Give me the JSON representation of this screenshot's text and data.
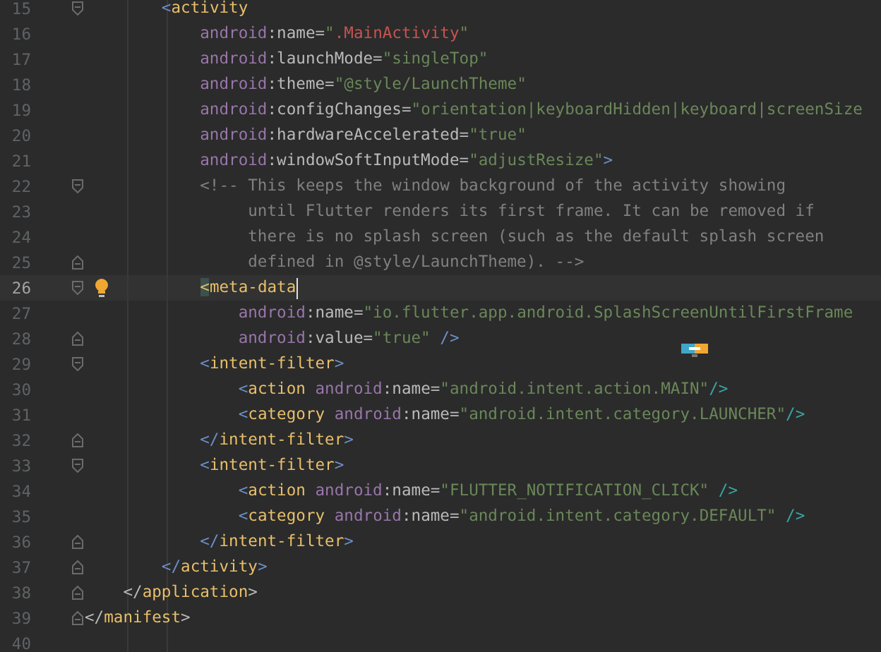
{
  "editor": {
    "lines": [
      {
        "number": "15",
        "fold": {
          "kind": "start"
        },
        "current": false,
        "bulb": false,
        "cursor": false,
        "tokens": [
          {
            "kind": "punct",
            "text": "        <"
          },
          {
            "kind": "tag",
            "text": "activity"
          }
        ]
      },
      {
        "number": "16",
        "current": false,
        "bulb": false,
        "cursor": false,
        "tokens": [
          {
            "kind": "ns",
            "text": "            android"
          },
          {
            "kind": "attr",
            "text": ":name="
          },
          {
            "kind": "str",
            "text": "\""
          },
          {
            "kind": "err",
            "text": ".MainActivity"
          },
          {
            "kind": "str",
            "text": "\""
          }
        ]
      },
      {
        "number": "17",
        "current": false,
        "bulb": false,
        "cursor": false,
        "tokens": [
          {
            "kind": "ns",
            "text": "            android"
          },
          {
            "kind": "attr",
            "text": ":launchMode="
          },
          {
            "kind": "str",
            "text": "\"singleTop\""
          }
        ]
      },
      {
        "number": "18",
        "current": false,
        "bulb": false,
        "cursor": false,
        "tokens": [
          {
            "kind": "ns",
            "text": "            android"
          },
          {
            "kind": "attr",
            "text": ":theme="
          },
          {
            "kind": "str",
            "text": "\"@style/LaunchTheme\""
          }
        ]
      },
      {
        "number": "19",
        "current": false,
        "bulb": false,
        "cursor": false,
        "tokens": [
          {
            "kind": "ns",
            "text": "            android"
          },
          {
            "kind": "attr",
            "text": ":configChanges="
          },
          {
            "kind": "str",
            "text": "\"orientation|keyboardHidden|keyboard|screenSize"
          }
        ]
      },
      {
        "number": "20",
        "current": false,
        "bulb": false,
        "cursor": false,
        "tokens": [
          {
            "kind": "ns",
            "text": "            android"
          },
          {
            "kind": "attr",
            "text": ":hardwareAccelerated="
          },
          {
            "kind": "str",
            "text": "\"true\""
          }
        ]
      },
      {
        "number": "21",
        "current": false,
        "bulb": false,
        "cursor": false,
        "tokens": [
          {
            "kind": "ns",
            "text": "            android"
          },
          {
            "kind": "attr",
            "text": ":windowSoftInputMode="
          },
          {
            "kind": "str",
            "text": "\"adjustResize\""
          },
          {
            "kind": "punct",
            "text": ">"
          }
        ]
      },
      {
        "number": "22",
        "fold": {
          "kind": "start"
        },
        "current": false,
        "bulb": false,
        "cursor": false,
        "tokens": [
          {
            "kind": "comment",
            "text": "            <!-- This keeps the window background of the activity showing"
          }
        ]
      },
      {
        "number": "23",
        "current": false,
        "bulb": false,
        "cursor": false,
        "tokens": [
          {
            "kind": "comment",
            "text": "                 until Flutter renders its first frame. It can be removed if"
          }
        ]
      },
      {
        "number": "24",
        "current": false,
        "bulb": false,
        "cursor": false,
        "tokens": [
          {
            "kind": "comment",
            "text": "                 there is no splash screen (such as the default splash screen"
          }
        ]
      },
      {
        "number": "25",
        "fold": {
          "kind": "end"
        },
        "current": false,
        "bulb": false,
        "cursor": false,
        "tokens": [
          {
            "kind": "comment",
            "text": "                 defined in @style/LaunchTheme). -->"
          }
        ]
      },
      {
        "number": "26",
        "fold": {
          "kind": "start"
        },
        "current": true,
        "bulb": true,
        "cursor": true,
        "tokens": [
          {
            "kind": "match",
            "text": "            <"
          },
          {
            "kind": "tag",
            "text": "meta-data"
          }
        ]
      },
      {
        "number": "27",
        "current": false,
        "bulb": false,
        "cursor": false,
        "tokens": [
          {
            "kind": "ns",
            "text": "                android"
          },
          {
            "kind": "attr",
            "text": ":name="
          },
          {
            "kind": "str",
            "text": "\"io.flutter.app.android.SplashScreenUntilFirstFrame"
          }
        ]
      },
      {
        "number": "28",
        "fold": {
          "kind": "end"
        },
        "current": false,
        "bulb": false,
        "cursor": false,
        "tokens": [
          {
            "kind": "ns",
            "text": "                android"
          },
          {
            "kind": "attr",
            "text": ":value="
          },
          {
            "kind": "str",
            "text": "\"true\" "
          },
          {
            "kind": "punct",
            "text": "/>"
          }
        ]
      },
      {
        "number": "29",
        "fold": {
          "kind": "start"
        },
        "current": false,
        "bulb": false,
        "cursor": false,
        "tokens": [
          {
            "kind": "punct",
            "text": "            <"
          },
          {
            "kind": "tag",
            "text": "intent-filter"
          },
          {
            "kind": "punct",
            "text": ">"
          }
        ]
      },
      {
        "number": "30",
        "current": false,
        "bulb": false,
        "cursor": false,
        "tokens": [
          {
            "kind": "punct",
            "text": "                <"
          },
          {
            "kind": "tag",
            "text": "action "
          },
          {
            "kind": "ns",
            "text": "android"
          },
          {
            "kind": "attr",
            "text": ":name="
          },
          {
            "kind": "str",
            "text": "\"android.intent.action.MAIN\""
          },
          {
            "kind": "close",
            "text": "/>"
          }
        ]
      },
      {
        "number": "31",
        "current": false,
        "bulb": false,
        "cursor": false,
        "tokens": [
          {
            "kind": "punct",
            "text": "                <"
          },
          {
            "kind": "tag",
            "text": "category "
          },
          {
            "kind": "ns",
            "text": "android"
          },
          {
            "kind": "attr",
            "text": ":name="
          },
          {
            "kind": "str",
            "text": "\"android.intent.category.LAUNCHER\""
          },
          {
            "kind": "close",
            "text": "/>"
          }
        ]
      },
      {
        "number": "32",
        "fold": {
          "kind": "end"
        },
        "current": false,
        "bulb": false,
        "cursor": false,
        "tokens": [
          {
            "kind": "punct",
            "text": "            </"
          },
          {
            "kind": "tag",
            "text": "intent-filter"
          },
          {
            "kind": "punct",
            "text": ">"
          }
        ]
      },
      {
        "number": "33",
        "fold": {
          "kind": "start"
        },
        "current": false,
        "bulb": false,
        "cursor": false,
        "tokens": [
          {
            "kind": "punct",
            "text": "            <"
          },
          {
            "kind": "tag",
            "text": "intent-filter"
          },
          {
            "kind": "punct",
            "text": ">"
          }
        ]
      },
      {
        "number": "34",
        "current": false,
        "bulb": false,
        "cursor": false,
        "tokens": [
          {
            "kind": "punct",
            "text": "                <"
          },
          {
            "kind": "tag",
            "text": "action "
          },
          {
            "kind": "ns",
            "text": "android"
          },
          {
            "kind": "attr",
            "text": ":name="
          },
          {
            "kind": "str",
            "text": "\"FLUTTER_NOTIFICATION_CLICK\" "
          },
          {
            "kind": "close",
            "text": "/>"
          }
        ]
      },
      {
        "number": "35",
        "current": false,
        "bulb": false,
        "cursor": false,
        "tokens": [
          {
            "kind": "punct",
            "text": "                <"
          },
          {
            "kind": "tag",
            "text": "category "
          },
          {
            "kind": "ns",
            "text": "android"
          },
          {
            "kind": "attr",
            "text": ":name="
          },
          {
            "kind": "str",
            "text": "\"android.intent.category.DEFAULT\" "
          },
          {
            "kind": "close",
            "text": "/>"
          }
        ]
      },
      {
        "number": "36",
        "fold": {
          "kind": "end"
        },
        "current": false,
        "bulb": false,
        "cursor": false,
        "tokens": [
          {
            "kind": "punct",
            "text": "            </"
          },
          {
            "kind": "tag",
            "text": "intent-filter"
          },
          {
            "kind": "punct",
            "text": ">"
          }
        ]
      },
      {
        "number": "37",
        "fold": {
          "kind": "end"
        },
        "current": false,
        "bulb": false,
        "cursor": false,
        "tokens": [
          {
            "kind": "punct",
            "text": "        </"
          },
          {
            "kind": "tag",
            "text": "activity"
          },
          {
            "kind": "punct",
            "text": ">"
          }
        ]
      },
      {
        "number": "38",
        "fold": {
          "kind": "end"
        },
        "current": false,
        "bulb": false,
        "cursor": false,
        "tokens": [
          {
            "kind": "plain",
            "text": "    </"
          },
          {
            "kind": "tag",
            "text": "application"
          },
          {
            "kind": "plain",
            "text": ">"
          }
        ]
      },
      {
        "number": "39",
        "fold": {
          "kind": "end"
        },
        "current": false,
        "bulb": false,
        "cursor": false,
        "tokens": [
          {
            "kind": "plain",
            "text": "</"
          },
          {
            "kind": "tag",
            "text": "manifest"
          },
          {
            "kind": "plain",
            "text": ">"
          }
        ]
      },
      {
        "number": "40",
        "current": false,
        "bulb": false,
        "cursor": false
      }
    ]
  }
}
